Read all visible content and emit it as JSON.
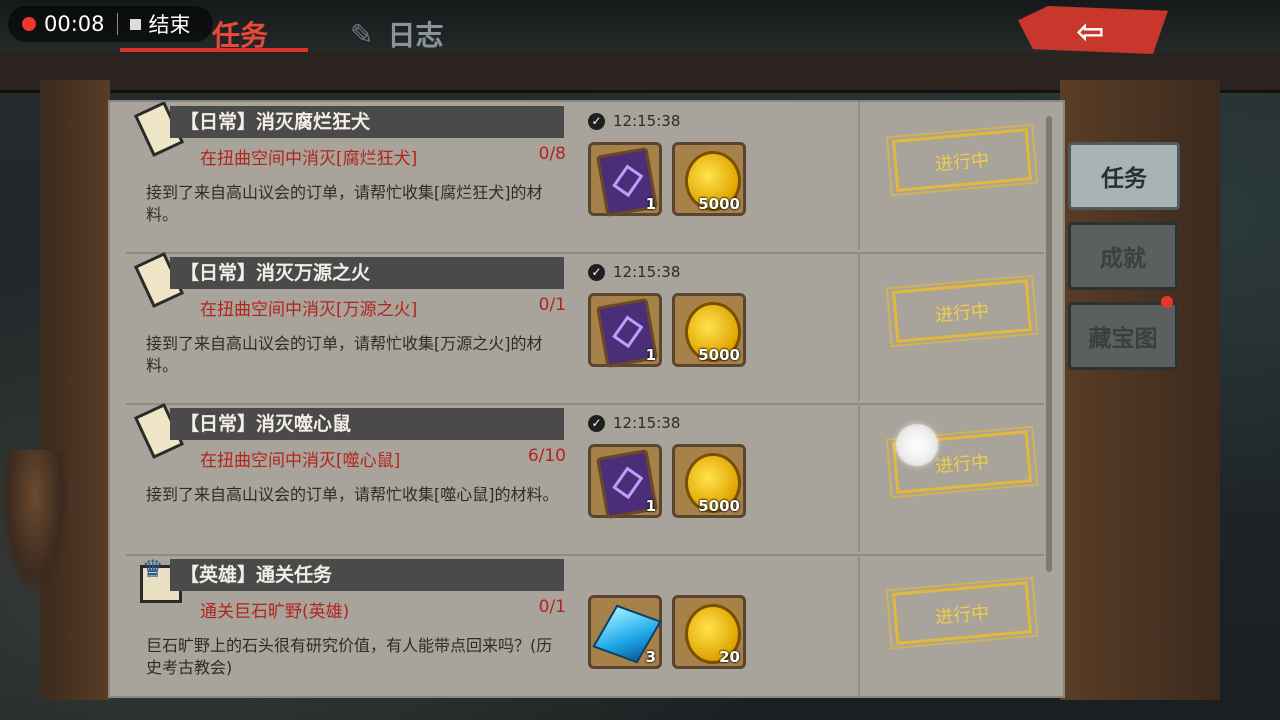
{
  "recording": {
    "time": "00:08",
    "stop_label": "结束"
  },
  "tabs": {
    "task": "任务",
    "log": "日志"
  },
  "side_tabs": [
    {
      "label": "任务"
    },
    {
      "label": "成就"
    },
    {
      "label": "藏宝图"
    }
  ],
  "quests": [
    {
      "title": "【日常】消灭腐烂狂犬",
      "objective": "在扭曲空间中消灭[腐烂狂犬]",
      "progress": "0/8",
      "description": "接到了来自高山议会的订单，请帮忙收集[腐烂狂犬]的材料。",
      "timer": "12:15:38",
      "rewards": [
        {
          "type": "book",
          "qty": "1"
        },
        {
          "type": "gold",
          "qty": "5000"
        }
      ],
      "status": "进行中"
    },
    {
      "title": "【日常】消灭万源之火",
      "objective": "在扭曲空间中消灭[万源之火]",
      "progress": "0/1",
      "description": "接到了来自高山议会的订单，请帮忙收集[万源之火]的材料。",
      "timer": "12:15:38",
      "rewards": [
        {
          "type": "book",
          "qty": "1"
        },
        {
          "type": "gold",
          "qty": "5000"
        }
      ],
      "status": "进行中"
    },
    {
      "title": "【日常】消灭噬心鼠",
      "objective": "在扭曲空间中消灭[噬心鼠]",
      "progress": "6/10",
      "description": "接到了来自高山议会的订单，请帮忙收集[噬心鼠]的材料。",
      "timer": "12:15:38",
      "rewards": [
        {
          "type": "book",
          "qty": "1"
        },
        {
          "type": "gold",
          "qty": "5000"
        }
      ],
      "status": "进行中"
    },
    {
      "title": "【英雄】通关任务",
      "objective": "通关巨石旷野(英雄)",
      "progress": "0/1",
      "description": "巨石旷野上的石头很有研究价值，有人能带点回来吗？(历史考古教会)",
      "timer": "",
      "rewards": [
        {
          "type": "crystal",
          "qty": "3"
        },
        {
          "type": "gold",
          "qty": "20"
        }
      ],
      "status": "进行中"
    }
  ]
}
